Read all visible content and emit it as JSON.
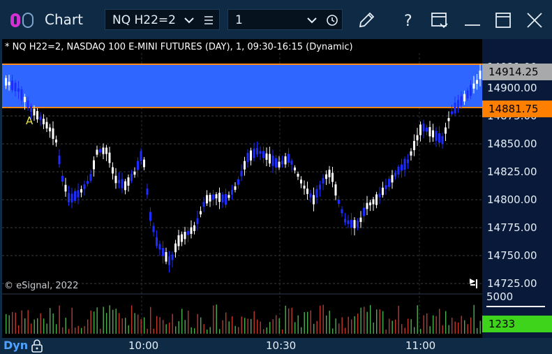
{
  "window": {
    "title": "Chart",
    "symbol_field": "NQ H22=2",
    "interval_field": "1"
  },
  "chart": {
    "info_line": "* NQ H22=2, NASDAQ 100 E-MINI FUTURES (DAY), 1, 09:30-16:15 (Dynamic)",
    "watermark": "© eSignal, 2022",
    "annotation_label": "A",
    "price_ticks": [
      "14921.00",
      "14900.00",
      "14875.00",
      "14850.00",
      "14825.00",
      "14800.00",
      "14775.00",
      "14750.00",
      "14725.00"
    ],
    "band_upper_label": "14914.25",
    "band_lower_label": "14881.75",
    "volume_tick": "5000",
    "volume_value": "1233",
    "time_ticks": [
      "10:00",
      "10:30",
      "11:00"
    ],
    "dyn_label": "Dyn"
  },
  "colors": {
    "band": "#2f66ff",
    "band_edge": "#ff8a1a",
    "up_candle": "#ffffff",
    "down_candle": "#1e2dff",
    "vol_up": "#4caf50",
    "vol_down": "#c0392b",
    "volume_badge": "#3ed41c"
  }
}
